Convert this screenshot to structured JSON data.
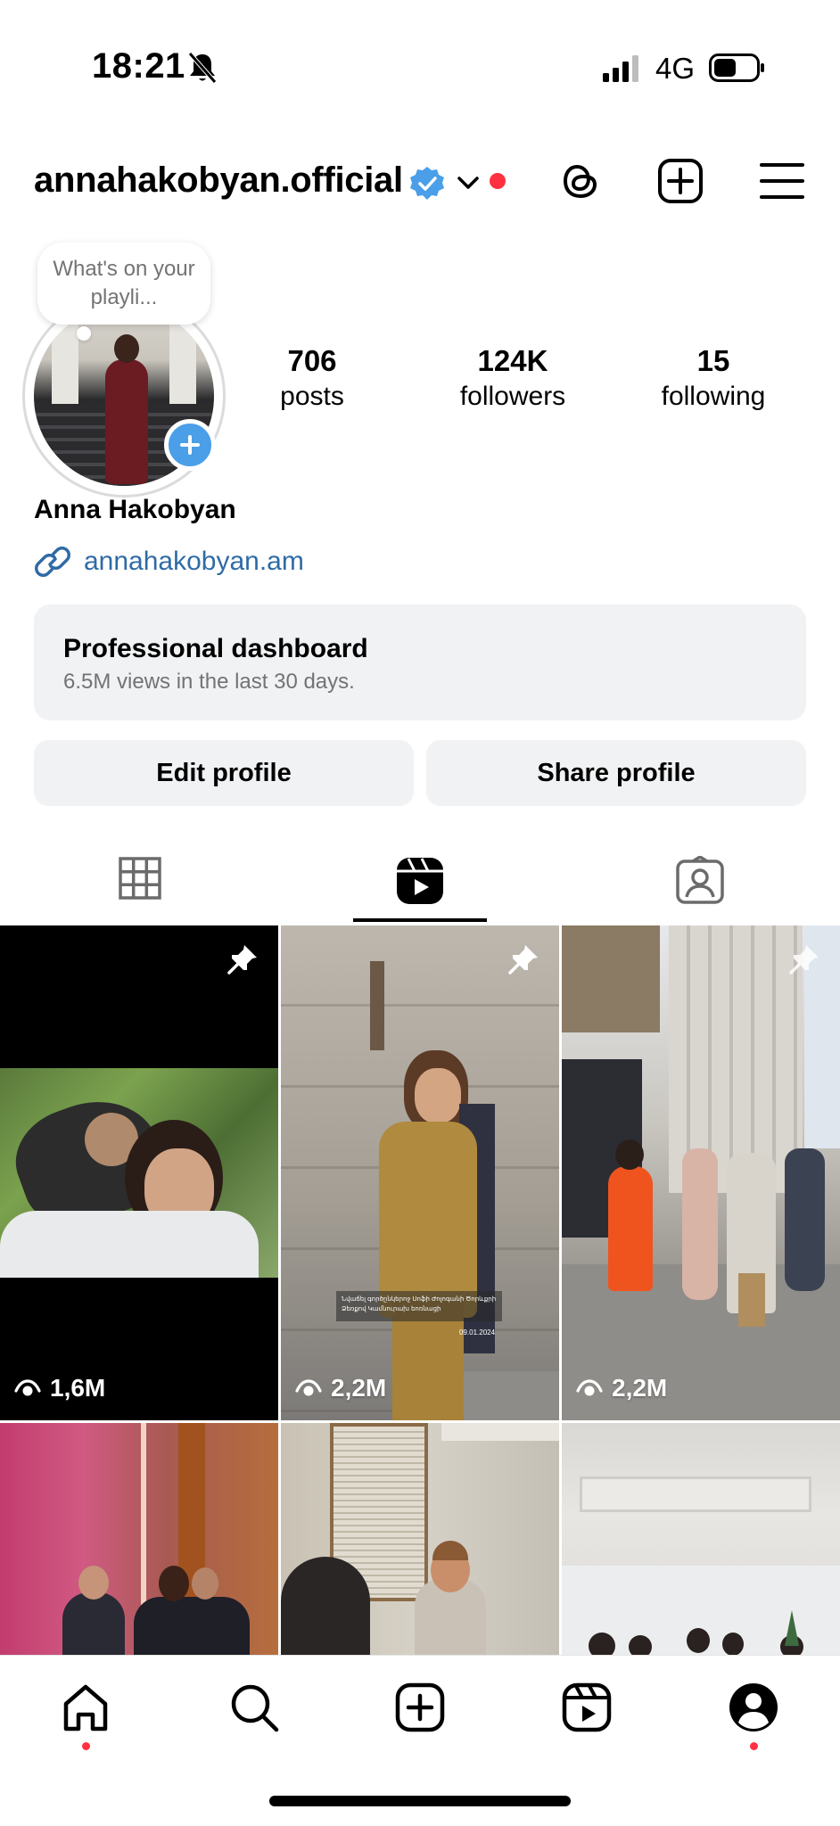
{
  "status_bar": {
    "time": "18:21",
    "network": "4G"
  },
  "header": {
    "username": "annahakobyan.official"
  },
  "profile": {
    "note": "What's on your playli...",
    "stats": [
      {
        "number": "706",
        "label": "posts"
      },
      {
        "number": "124K",
        "label": "followers"
      },
      {
        "number": "15",
        "label": "following"
      }
    ],
    "full_name": "Anna Hakobyan",
    "website": "annahakobyan.am"
  },
  "dashboard": {
    "title": "Professional dashboard",
    "subtitle": "6.5M views in the last 30 days."
  },
  "buttons": {
    "edit": "Edit profile",
    "share": "Share profile"
  },
  "tabs": [
    {
      "icon": "grid-icon",
      "active": false
    },
    {
      "icon": "reels-icon",
      "active": true
    },
    {
      "icon": "tagged-icon",
      "active": false
    }
  ],
  "reels": [
    {
      "views": "1,6M",
      "pinned": true
    },
    {
      "views": "2,2M",
      "pinned": true,
      "caption_lines": [
        "Նվաճել գործընկերոջ Սոֆի Ժոլոգանի Ծորևքրի",
        "Ձեռքով Կամնուրախ եոռնացի"
      ],
      "date": "09.01.2024"
    },
    {
      "views": "2,2M",
      "pinned": true
    },
    {
      "views": ""
    },
    {
      "views": ""
    },
    {
      "views": ""
    }
  ],
  "colors": {
    "accent_blue": "#4a9fe8",
    "link": "#2f6ba5",
    "notification_red": "#ff3040",
    "button_bg": "#f1f2f4"
  }
}
